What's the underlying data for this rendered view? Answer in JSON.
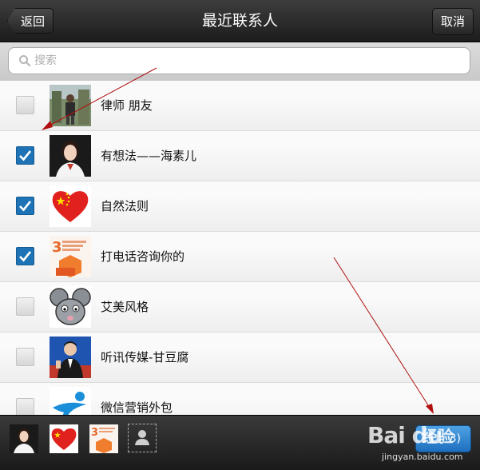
{
  "header": {
    "back_label": "返回",
    "title": "最近联系人",
    "cancel_label": "取消"
  },
  "search": {
    "placeholder": "搜索"
  },
  "contacts": [
    {
      "name": "律师 朋友",
      "checked": false,
      "avatar": "photo-man-outdoor"
    },
    {
      "name": "有想法——海素儿",
      "checked": true,
      "avatar": "photo-woman"
    },
    {
      "name": "自然法则",
      "checked": true,
      "avatar": "red-heart-flag"
    },
    {
      "name": "打电话咨询你的",
      "checked": true,
      "avatar": "poster-orange"
    },
    {
      "name": "艾美风格",
      "checked": false,
      "avatar": "cartoon-mouse"
    },
    {
      "name": "听讯传媒-甘豆腐",
      "checked": false,
      "avatar": "photo-man-suit"
    },
    {
      "name": "微信营销外包",
      "checked": false,
      "avatar": "blue-logo"
    }
  ],
  "footer": {
    "confirm_label": "3)"
  },
  "watermark": {
    "logo": "Bai du",
    "text": "经验",
    "site": "jingyan.baidu.com"
  },
  "colors": {
    "accent": "#1d73b5",
    "annotation": "#b01010"
  }
}
